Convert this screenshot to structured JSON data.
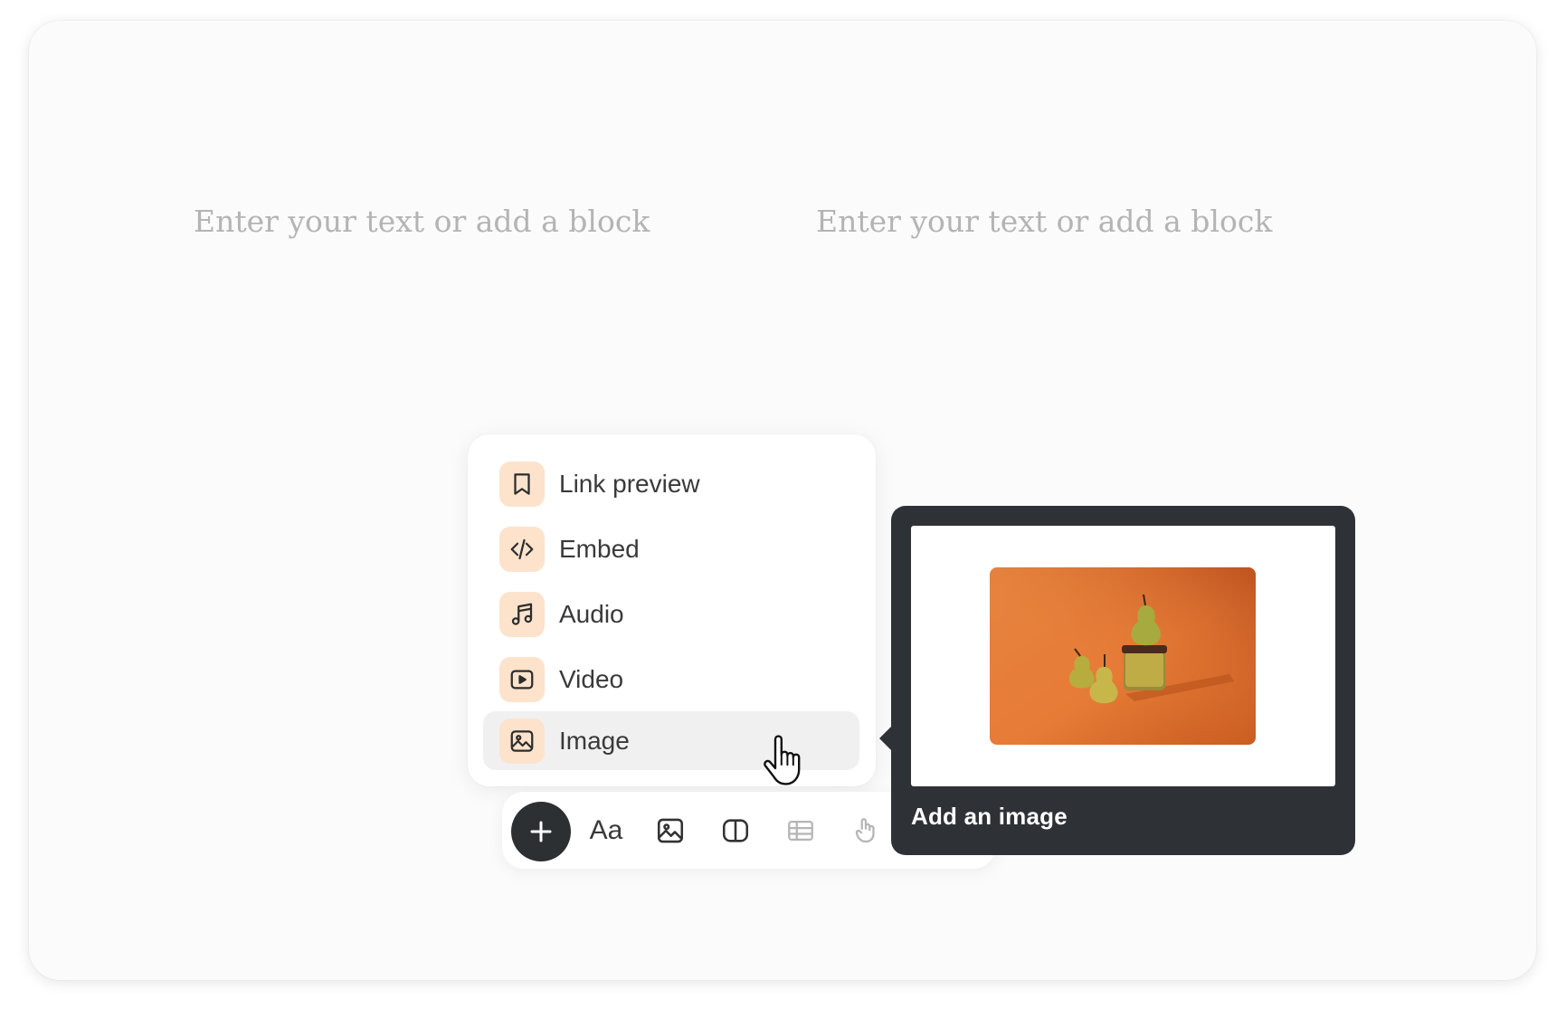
{
  "editor": {
    "left_column": {
      "placeholder": "Enter your text or add a block"
    },
    "right_column": {
      "placeholder": "Enter your text or add a block"
    }
  },
  "insert_menu": {
    "items": [
      {
        "label": "Link preview",
        "icon": "bookmark-icon"
      },
      {
        "label": "Embed",
        "icon": "code-icon"
      },
      {
        "label": "Audio",
        "icon": "music-note-icon"
      },
      {
        "label": "Video",
        "icon": "play-icon"
      },
      {
        "label": "Image",
        "icon": "image-icon",
        "active": true
      }
    ]
  },
  "toolbar": {
    "add_icon": "plus-icon",
    "text_label": "Aa",
    "buttons": [
      "text-style-icon",
      "image-icon",
      "columns-icon",
      "table-icon",
      "gesture-icon"
    ]
  },
  "tooltip": {
    "caption": "Add an image",
    "preview_image": "pears-on-orange-background"
  },
  "colors": {
    "icon_bg": "#fde3cc",
    "tooltip_bg": "#2e3236",
    "placeholder_text": "#b4b4b4",
    "active_item_bg": "#f0f0f0"
  }
}
